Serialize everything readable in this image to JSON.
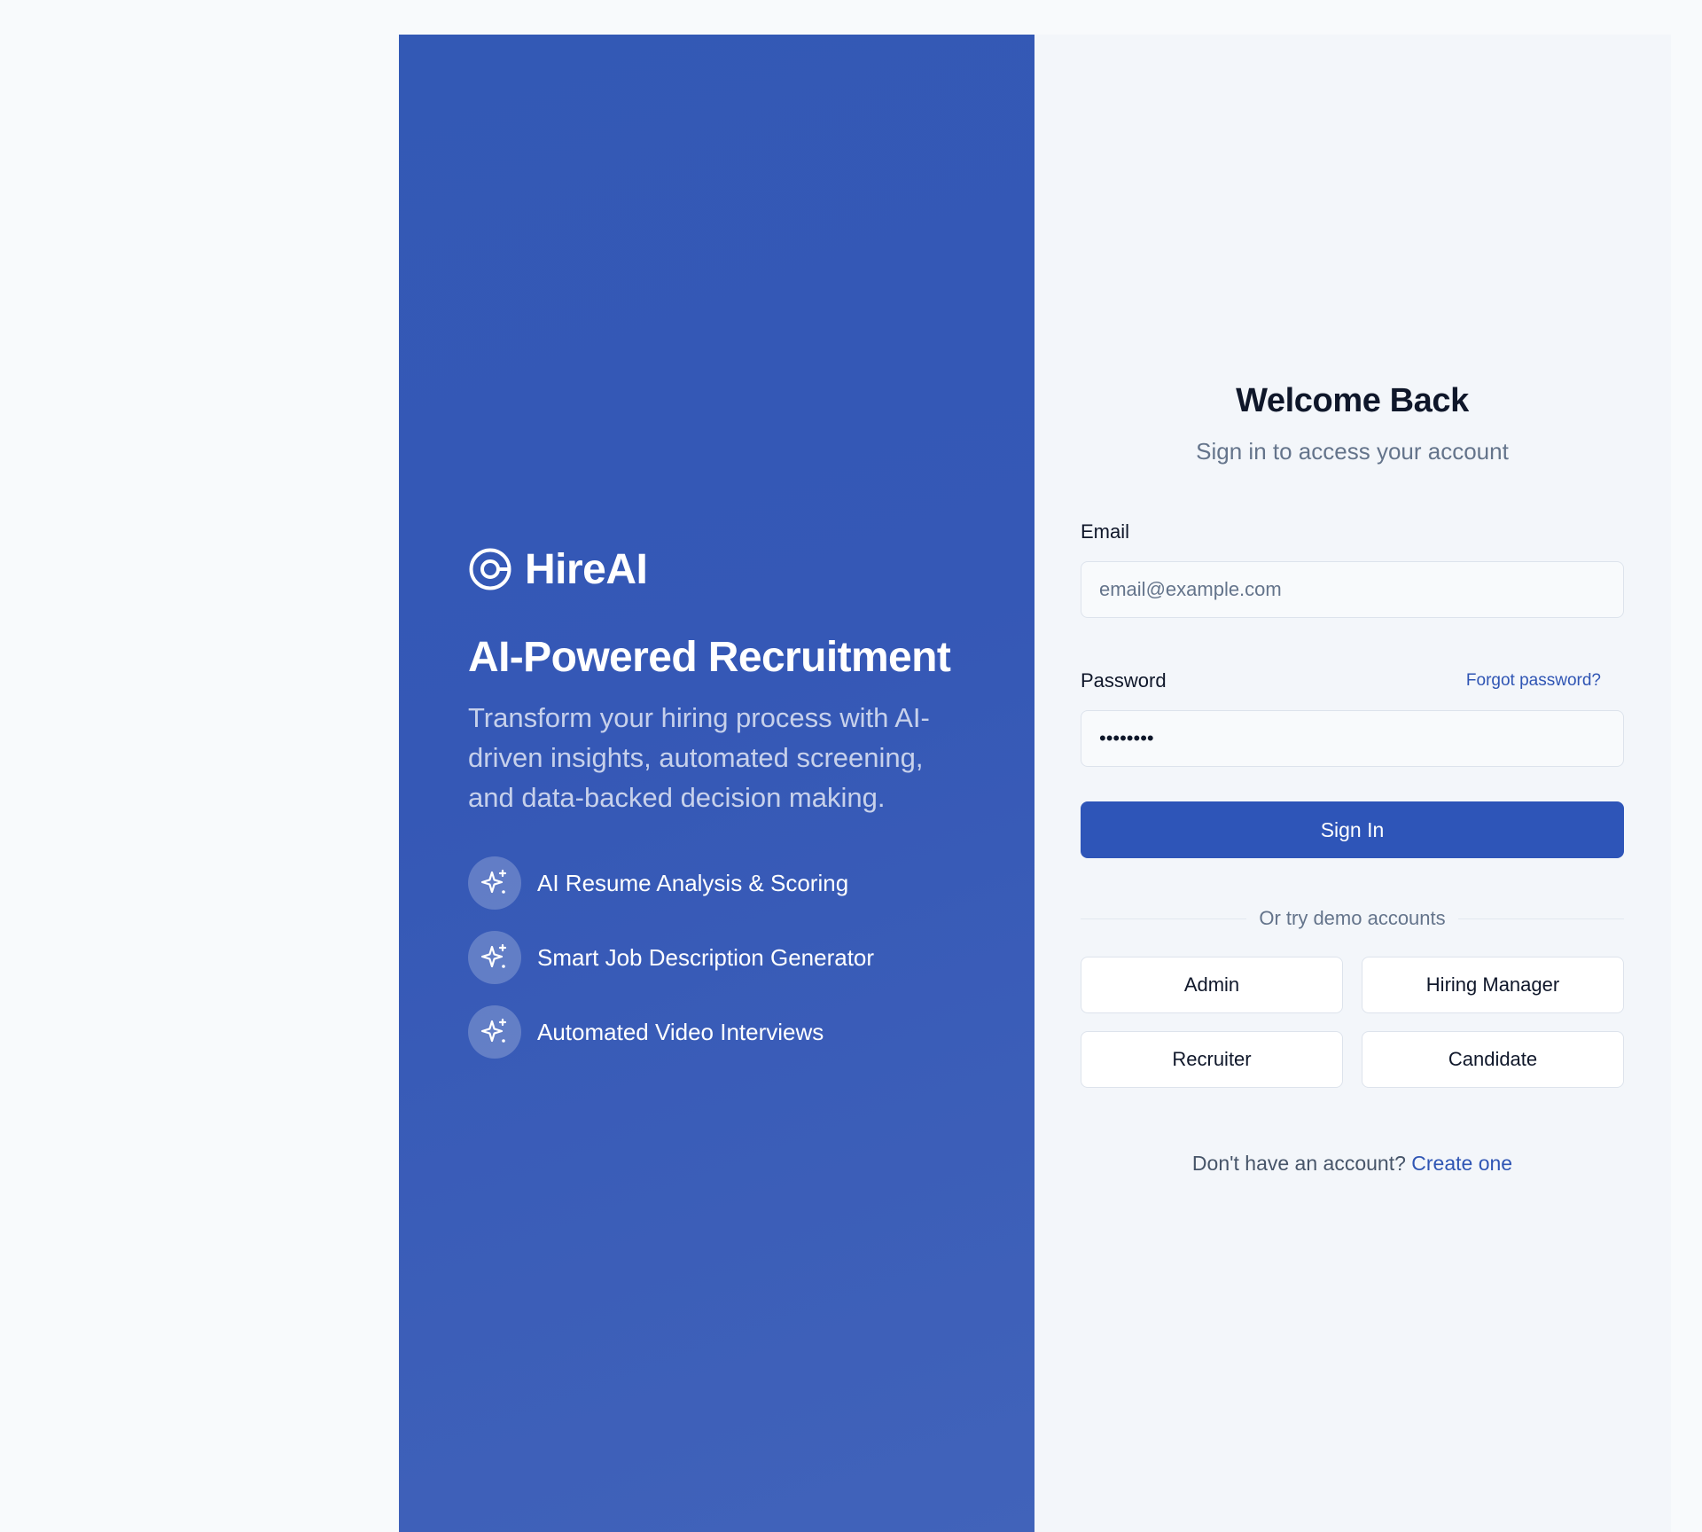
{
  "hero": {
    "brand_name": "HireAI",
    "headline": "AI-Powered Recruitment",
    "tagline": "Transform your hiring process with AI-driven insights, automated screening, and data-backed decision making.",
    "features": [
      {
        "icon": "sparkles-icon",
        "label": "AI Resume Analysis & Scoring"
      },
      {
        "icon": "sparkles-icon",
        "label": "Smart Job Description Generator"
      },
      {
        "icon": "sparkles-icon",
        "label": "Automated Video Interviews"
      }
    ]
  },
  "login": {
    "title": "Welcome Back",
    "subtitle": "Sign in to access your account",
    "email_label": "Email",
    "email_placeholder": "email@example.com",
    "email_value": "",
    "password_label": "Password",
    "password_value": "password",
    "forgot_label": "Forgot password?",
    "signin_label": "Sign In",
    "divider_text": "Or try demo accounts",
    "demo_accounts": [
      "Admin",
      "Hiring Manager",
      "Recruiter",
      "Candidate"
    ],
    "signup_prompt": "Don't have an account?",
    "signup_link": "Create one"
  },
  "colors": {
    "brand_blue": "#3558b6",
    "button_blue": "#2e55b8",
    "link_blue": "#2f55b4",
    "panel_bg": "#f3f6fa"
  }
}
